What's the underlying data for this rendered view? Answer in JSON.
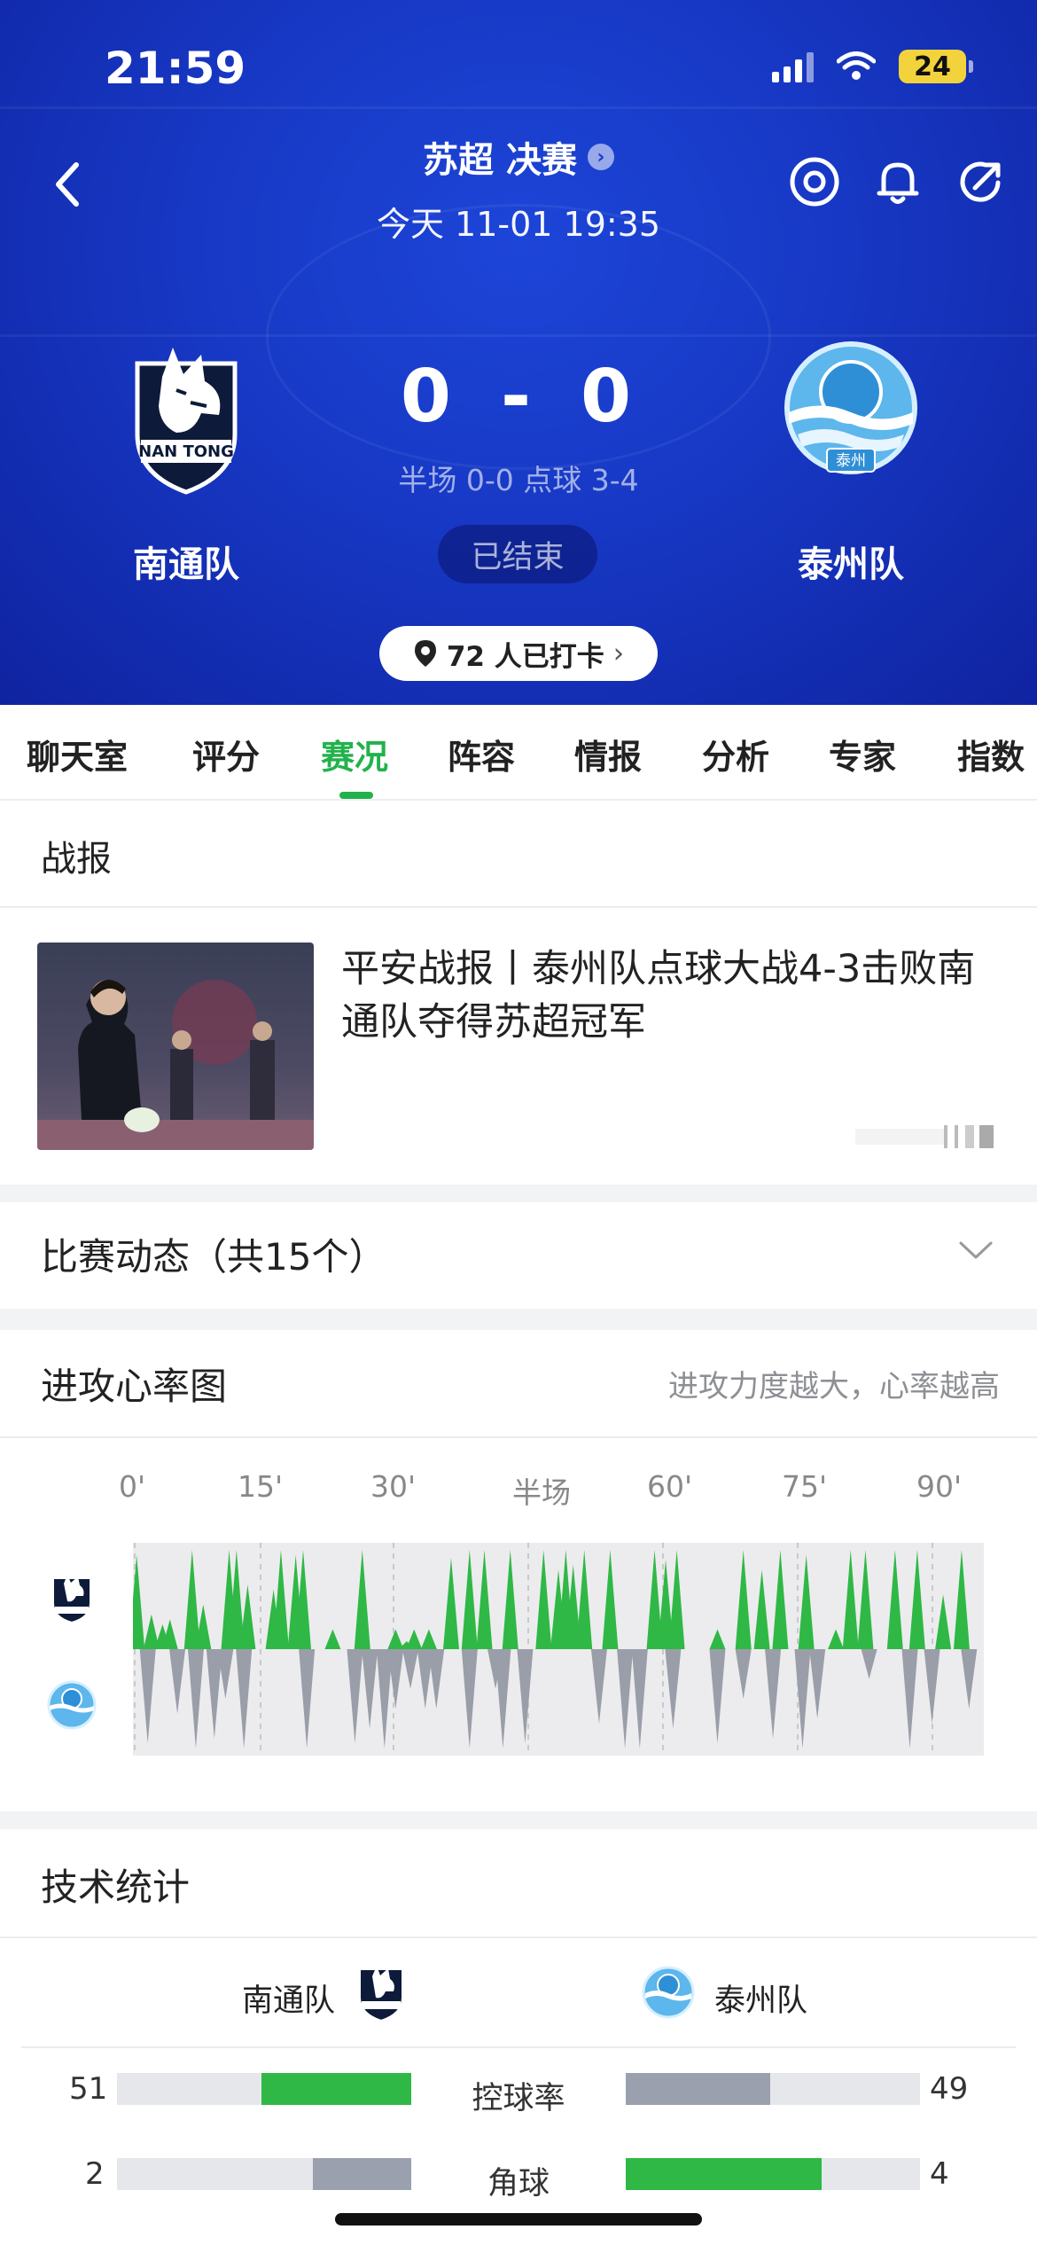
{
  "status_bar": {
    "time": "21:59",
    "battery": "24"
  },
  "header": {
    "title": "苏超 决赛",
    "datetime": "今天 11-01 19:35",
    "home_team": "南通队",
    "away_team": "泰州队",
    "home_score": "0",
    "away_score": "0",
    "score_separator": "-",
    "sub_score": "半场 0-0 点球 3-4",
    "status": "已结束",
    "checkin": "72 人已打卡",
    "home_logo_text": "NAN TONG",
    "away_logo_text": "泰州"
  },
  "tabs": [
    {
      "label": "聊天室"
    },
    {
      "label": "评分"
    },
    {
      "label": "赛况",
      "active": true
    },
    {
      "label": "阵容"
    },
    {
      "label": "情报"
    },
    {
      "label": "分析"
    },
    {
      "label": "专家"
    },
    {
      "label": "指数"
    }
  ],
  "report": {
    "section_title": "战报",
    "headline": "平安战报丨泰州队点球大战4-3击败南通队夺得苏超冠军"
  },
  "dynamics": {
    "title": "比赛动态（共15个）"
  },
  "heart_rate": {
    "title": "进攻心率图",
    "hint": "进攻力度越大，心率越高",
    "ticks": [
      "0'",
      "15'",
      "30'",
      "半场",
      "60'",
      "75'",
      "90'"
    ],
    "colors": {
      "home": "#2fb845",
      "away": "#9a9ea8",
      "track": "#ececee"
    },
    "home_peaks": [
      [
        1,
        0.95
      ],
      [
        5,
        0.35
      ],
      [
        8,
        0.25
      ],
      [
        10,
        0.3
      ],
      [
        16,
        1
      ],
      [
        19,
        0.45
      ],
      [
        26,
        1
      ],
      [
        28,
        1
      ],
      [
        31,
        0.65
      ],
      [
        38,
        0.6
      ],
      [
        40,
        1
      ],
      [
        44,
        0.95
      ],
      [
        46,
        1
      ],
      [
        54,
        0.2
      ],
      [
        62,
        1
      ],
      [
        71,
        0.2
      ],
      [
        74,
        0.08
      ],
      [
        76,
        0.2
      ],
      [
        80,
        0.2
      ],
      [
        86,
        0.92
      ],
      [
        91,
        1
      ],
      [
        95,
        1
      ],
      [
        102,
        1
      ],
      [
        111,
        1
      ],
      [
        115,
        0.8
      ],
      [
        117,
        1
      ],
      [
        119,
        0.85
      ],
      [
        122,
        1
      ],
      [
        129,
        1
      ],
      [
        141,
        1
      ],
      [
        144,
        0.9
      ],
      [
        147,
        1
      ],
      [
        158,
        0.2
      ],
      [
        165,
        1
      ],
      [
        170,
        0.8
      ],
      [
        175,
        1
      ],
      [
        182,
        0.95
      ],
      [
        190,
        0.2
      ],
      [
        194,
        1
      ],
      [
        198,
        1
      ],
      [
        206,
        1
      ],
      [
        212,
        1
      ],
      [
        219,
        0.55
      ],
      [
        224,
        1
      ]
    ],
    "away_peaks": [
      [
        4,
        0.95
      ],
      [
        12,
        0.65
      ],
      [
        17,
        1
      ],
      [
        22,
        0.9
      ],
      [
        25,
        0.5
      ],
      [
        30,
        1
      ],
      [
        47,
        1
      ],
      [
        60,
        0.95
      ],
      [
        64,
        0.8
      ],
      [
        68,
        1
      ],
      [
        71,
        0.6
      ],
      [
        75,
        0.4
      ],
      [
        79,
        0.6
      ],
      [
        82,
        0.6
      ],
      [
        91,
        1
      ],
      [
        98,
        0.4
      ],
      [
        100,
        1
      ],
      [
        106,
        0.95
      ],
      [
        126,
        0.75
      ],
      [
        133,
        1
      ],
      [
        137,
        1
      ],
      [
        146,
        0.8
      ],
      [
        158,
        0.95
      ],
      [
        165,
        0.5
      ],
      [
        173,
        0.9
      ],
      [
        181,
        1
      ],
      [
        185,
        0.7
      ],
      [
        199,
        0.3
      ],
      [
        210,
        1
      ],
      [
        216,
        0.75
      ],
      [
        226,
        0.6
      ]
    ]
  },
  "tech": {
    "title": "技术统计",
    "home_team": "南通队",
    "away_team": "泰州队",
    "rows": [
      {
        "label": "控球率",
        "home": "51",
        "away": "49",
        "home_val": 51,
        "away_val": 49,
        "max": 100,
        "home_lead": true
      },
      {
        "label": "角球",
        "home": "2",
        "away": "4",
        "home_val": 2,
        "away_val": 4,
        "max": 6,
        "home_lead": false
      }
    ]
  }
}
